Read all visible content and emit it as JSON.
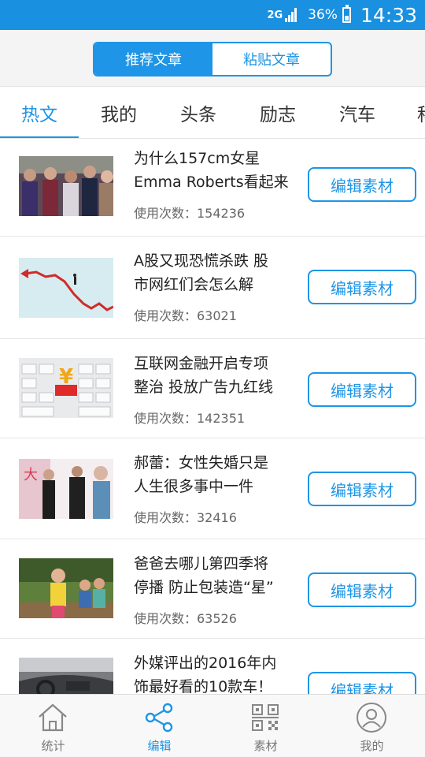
{
  "status_bar": {
    "network": "2G",
    "battery_percent": "36%",
    "time": "14:33",
    "battery_level": 0.36
  },
  "segment": {
    "items": [
      {
        "label": "推荐文章",
        "active": true
      },
      {
        "label": "粘贴文章",
        "active": false
      }
    ]
  },
  "tabs": [
    {
      "label": "热文",
      "active": true
    },
    {
      "label": "我的"
    },
    {
      "label": "头条"
    },
    {
      "label": "励志"
    },
    {
      "label": "汽车"
    },
    {
      "label": "科"
    }
  ],
  "articles": [
    {
      "title_line1": "为什么157cm女星",
      "title_line2": "Emma Roberts看起来",
      "count": "使用次数：154236",
      "button": "编辑素材",
      "thumb": "crowd-photo"
    },
    {
      "title_line1": "A股又现恐慌杀跌 股",
      "title_line2": "市网红们会怎么解",
      "count": "使用次数：63021",
      "button": "编辑素材",
      "thumb": "stock-chart-photo"
    },
    {
      "title_line1": "互联网金融开启专项",
      "title_line2": "整治 投放广告九红线",
      "count": "使用次数：142351",
      "button": "编辑素材",
      "thumb": "keyboard-yen-photo"
    },
    {
      "title_line1": "郝蕾：女性失婚只是",
      "title_line2": "人生很多事中一件",
      "count": "使用次数：32416",
      "button": "编辑素材",
      "thumb": "stage-photo"
    },
    {
      "title_line1": "爸爸去哪儿第四季将",
      "title_line2": "停播 防止包装造“星”",
      "count": "使用次数：63526",
      "button": "编辑素材",
      "thumb": "kids-photo"
    },
    {
      "title_line1": "外媒评出的2016年内",
      "title_line2": "饰最好看的10款车！",
      "count": "",
      "button": "编辑素材",
      "thumb": "car-interior-photo"
    }
  ],
  "bottom_nav": [
    {
      "label": "统计",
      "icon": "home-icon",
      "active": false
    },
    {
      "label": "编辑",
      "icon": "share-icon",
      "active": true
    },
    {
      "label": "素材",
      "icon": "qr-icon",
      "active": false
    },
    {
      "label": "我的",
      "icon": "user-icon",
      "active": false
    }
  ],
  "colors": {
    "accent": "#1e95e6",
    "status_bar": "#1a90e0"
  }
}
